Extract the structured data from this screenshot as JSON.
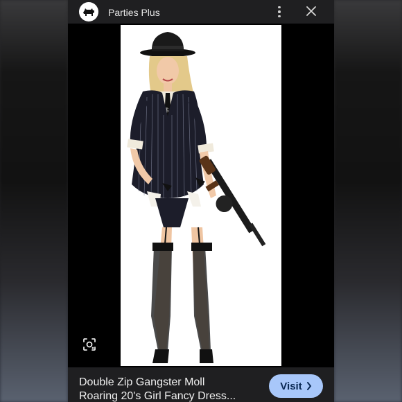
{
  "header": {
    "site_name": "Parties Plus",
    "logo_icon": "scottie-dog-logo",
    "more_icon": "more-vert-icon",
    "close_icon": "close-icon"
  },
  "image": {
    "subject": "gangster-costume-photo"
  },
  "footer": {
    "title_line1": "Double Zip Gangster Moll",
    "title_line2": "Roaring 20's Girl Fancy Dress...",
    "visit_label": "Visit",
    "visit_icon": "chevron-right-icon",
    "accent_color": "#a8c7fa"
  },
  "lens_icon": "lens-search-icon"
}
